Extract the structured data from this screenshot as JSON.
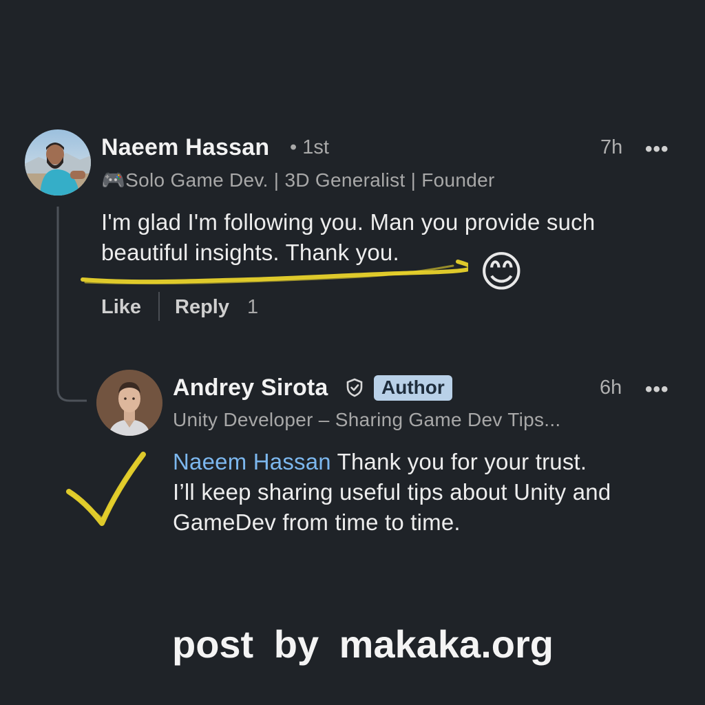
{
  "comment": {
    "author": "Naeem Hassan",
    "degree": "1st",
    "time": "7h",
    "more_label": "•••",
    "headline_emoji": "🎮",
    "headline": "Solo Game Dev. | 3D Generalist | Founder",
    "text_line1": "I'm glad I'm following you. Man you provide such",
    "text_line2": "beautiful insights. Thank you.",
    "like_label": "Like",
    "reply_label": "Reply",
    "reply_count": "1"
  },
  "reply": {
    "author": "Andrey Sirota",
    "badge": "Author",
    "time": "6h",
    "more_label": "•••",
    "headline": "Unity Developer – Sharing Game Dev Tips...",
    "mention": "Naeem Hassan",
    "text_line1_rest": " Thank you for your trust.",
    "text_line2": "I’ll keep sharing useful tips about Unity and",
    "text_line3": "GameDev from time to time."
  },
  "annotations": {
    "emoji": "😊",
    "highlight_color": "#f0dc2c"
  },
  "footer": {
    "text": "post by makaka.org"
  },
  "colors": {
    "background": "#1f2328",
    "mention": "#7cb7ee",
    "badge_bg": "#b9d1e8"
  }
}
